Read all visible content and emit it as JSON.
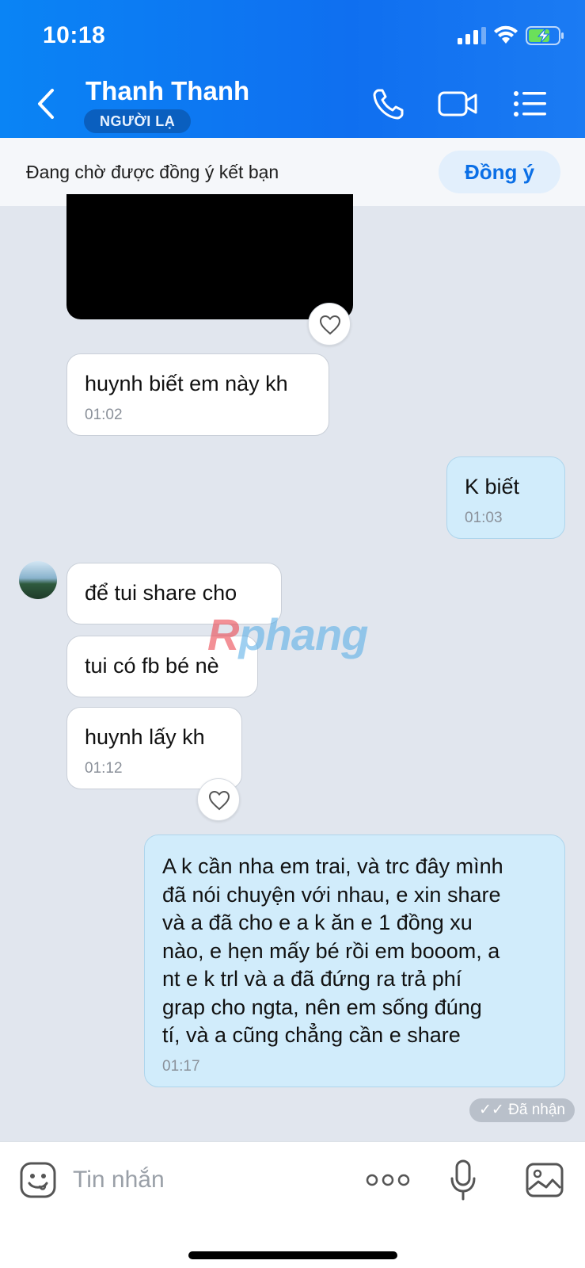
{
  "status_bar": {
    "time": "10:18"
  },
  "header": {
    "contact_name": "Thanh Thanh",
    "badge": "NGƯỜI LẠ",
    "icons": [
      "back-icon",
      "phone-icon",
      "video-call-icon",
      "menu-list-icon"
    ]
  },
  "friend_request": {
    "text": "Đang chờ được đồng ý kết bạn",
    "accept_label": "Đồng ý"
  },
  "messages": [
    {
      "direction": "in",
      "text": "huynh biết em này kh",
      "time": "01:02"
    },
    {
      "direction": "out",
      "text": "K biết",
      "time": "01:03"
    },
    {
      "direction": "in",
      "text": "để tui share cho",
      "time": ""
    },
    {
      "direction": "in",
      "text": "tui có fb bé nè",
      "time": ""
    },
    {
      "direction": "in",
      "text": "huynh lấy kh",
      "time": "01:12"
    },
    {
      "direction": "out",
      "text": "A k cần nha em trai, và trc đây mình\nđã nói chuyện với nhau, e xin share\nvà a đã cho e a k ăn e 1 đồng xu\nnào, e hẹn mấy bé rồi em booom, a\nnt e k trl và a đã đứng ra trả phí\ngrap cho ngta, nên em sống đúng\ntí, và a cũng chẳng cần e share",
      "time": "01:17"
    }
  ],
  "received_status": "Đã nhận",
  "watermark": {
    "first": "R",
    "rest": "phang"
  },
  "composer": {
    "placeholder": "Tin nhắn",
    "icons": [
      "emoji-icon",
      "more-options-icon",
      "microphone-icon",
      "image-gallery-icon"
    ]
  },
  "colors": {
    "header": "#0f6ff0",
    "outgoing_bubble": "#d1ecfb",
    "incoming_bubble": "#ffffff",
    "background": "#e1e6ee",
    "accent": "#0b6fe6"
  }
}
